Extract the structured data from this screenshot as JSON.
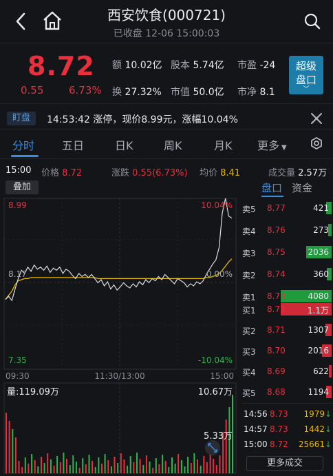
{
  "header": {
    "title": "西安饮食(000721)",
    "subtitle": "已收盘 12-06 15:00:03"
  },
  "quote": {
    "price": "8.72",
    "change": "0.55",
    "change_pct": "6.73%",
    "amount_label": "额",
    "amount": "10.02亿",
    "shares_label": "股本",
    "shares": "5.74亿",
    "pe_label": "市盈",
    "pe": "-24",
    "turnover_label": "换",
    "turnover": "27.32%",
    "mktcap_label": "市值",
    "mktcap": "50.0亿",
    "pb_label": "市净",
    "pb": "8.1",
    "super_label_1": "超级",
    "super_label_2": "盘口"
  },
  "alert": {
    "tag": "盯盘",
    "text": "14:53:42 涨停，现价8.99元，涨幅10.04%"
  },
  "tabs": [
    "分时",
    "五日",
    "日K",
    "周K",
    "月K",
    "更多"
  ],
  "info": {
    "time": "15:00",
    "price_label": "价格",
    "price": "8.72",
    "chg_label": "涨跌",
    "chg": "0.55(6.73%)",
    "avg_label": "均价",
    "avg": "8.41",
    "vol_label": "成交量",
    "vol": "2.57万"
  },
  "overlay_label": "叠加",
  "right_tabs": [
    "盘口",
    "资金"
  ],
  "chart_data": {
    "type": "line",
    "y_top": "8.99",
    "y_top_pct": "10.04%",
    "y_mid": "8.17",
    "y_mid_pct": "0.00%",
    "y_bot": "7.35",
    "y_bot_pct": "-10.04%",
    "prev_close": 8.17,
    "ylim": [
      7.35,
      8.99
    ],
    "x_labels": [
      "09:30",
      "11:30/13:00",
      "15:00"
    ],
    "price_series": [
      8.02,
      8.05,
      8.01,
      8.12,
      8.22,
      8.3,
      8.27,
      8.33,
      8.29,
      8.35,
      8.31,
      8.33,
      8.3,
      8.34,
      8.28,
      8.32,
      8.3,
      8.33,
      8.27,
      8.31,
      8.29,
      8.25,
      8.22,
      8.27,
      8.24,
      8.26,
      8.23,
      8.26,
      8.22,
      8.18,
      8.21,
      8.15,
      8.19,
      8.12,
      8.16,
      8.11,
      8.14,
      8.18,
      8.15,
      8.13,
      8.17,
      8.14,
      8.19,
      8.16,
      8.21,
      8.18,
      8.22,
      8.2,
      8.24,
      8.21,
      8.26,
      8.23,
      8.2,
      8.17,
      8.22,
      8.2,
      8.18,
      8.14,
      8.17,
      8.15,
      8.19,
      8.17,
      8.2,
      8.26,
      8.31,
      8.36,
      8.4,
      8.52,
      8.85,
      8.99,
      8.82,
      8.8
    ],
    "avg_series": [
      8.02,
      8.06,
      8.1,
      8.16,
      8.2,
      8.21,
      8.22,
      8.22,
      8.23,
      8.23,
      8.23,
      8.23,
      8.23,
      8.23,
      8.23,
      8.23,
      8.23,
      8.23,
      8.23,
      8.23,
      8.23,
      8.23,
      8.23,
      8.23,
      8.23,
      8.23,
      8.23,
      8.23,
      8.23,
      8.22,
      8.22,
      8.22,
      8.22,
      8.22,
      8.22,
      8.22,
      8.22,
      8.22,
      8.22,
      8.22,
      8.22,
      8.22,
      8.22,
      8.22,
      8.22,
      8.22,
      8.22,
      8.22,
      8.22,
      8.22,
      8.22,
      8.22,
      8.22,
      8.22,
      8.22,
      8.22,
      8.22,
      8.22,
      8.22,
      8.22,
      8.22,
      8.22,
      8.22,
      8.23,
      8.23,
      8.24,
      8.25,
      8.27,
      8.3,
      8.34,
      8.38,
      8.41
    ],
    "volume_label": "量:119.09万",
    "vol_max_label": "10.67万",
    "vol_mid_label": "5.33万"
  },
  "orderbook": {
    "asks": [
      {
        "label": "卖5",
        "price": "8.77",
        "qty": "421"
      },
      {
        "label": "卖4",
        "price": "8.76",
        "qty": "273"
      },
      {
        "label": "卖3",
        "price": "8.75",
        "qty": "2036"
      },
      {
        "label": "卖2",
        "price": "8.74",
        "qty": "360"
      },
      {
        "label": "卖1",
        "price": "8.73",
        "qty": "4080"
      }
    ],
    "bids": [
      {
        "label": "买1",
        "price": "8.72",
        "qty": "1.1万"
      },
      {
        "label": "买2",
        "price": "8.71",
        "qty": "1307"
      },
      {
        "label": "买3",
        "price": "8.70",
        "qty": "2016"
      },
      {
        "label": "买4",
        "price": "8.69",
        "qty": "622"
      },
      {
        "label": "买5",
        "price": "8.68",
        "qty": "1194"
      }
    ]
  },
  "trades": [
    {
      "time": "14:56",
      "price": "8.73",
      "qty": "1979"
    },
    {
      "time": "14:57",
      "price": "8.73",
      "qty": "1442"
    },
    {
      "time": "15:00",
      "price": "8.72",
      "qty": "25661"
    }
  ],
  "more_trades": "更多成交"
}
